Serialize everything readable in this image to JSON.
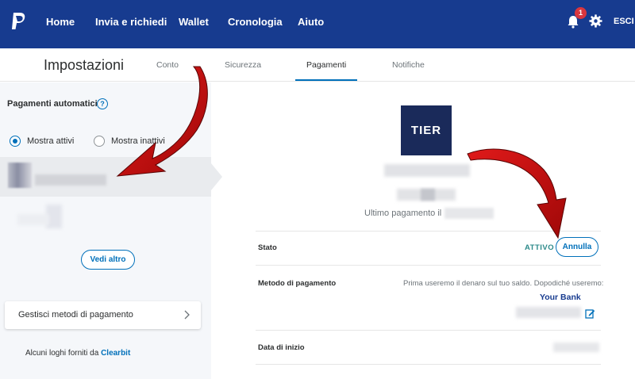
{
  "nav": {
    "items": [
      "Home",
      "Invia e richiedi",
      "Wallet",
      "Cronologia",
      "Aiuto"
    ],
    "notifications_count": "1",
    "logout_label": "ESCI"
  },
  "subnav": {
    "title": "Impostazioni",
    "tabs": [
      "Conto",
      "Sicurezza",
      "Pagamenti",
      "Notifiche"
    ],
    "active_tab": "Pagamenti"
  },
  "left_panel": {
    "title": "Pagamenti automatici",
    "help_icon": "?",
    "filters": [
      {
        "label": "Mostra attivi",
        "selected": true
      },
      {
        "label": "Mostra inattivi",
        "selected": false
      }
    ],
    "see_more_label": "Vedi altro",
    "manage_label": "Gestisci metodi di pagamento",
    "credits_prefix": "Alcuni loghi forniti da",
    "credits_brand": "Clearbit"
  },
  "detail": {
    "merchant_logo_text": "TIER",
    "last_payment_label": "Ultimo pagamento il",
    "status_label": "Stato",
    "status_value": "ATTIVO",
    "cancel_label": "Annulla",
    "method_label": "Metodo di pagamento",
    "method_text": "Prima useremo il denaro sul tuo saldo. Dopodiché useremo:",
    "bank_name": "Your Bank",
    "start_date_label": "Data di inizio"
  },
  "colors": {
    "brand_navy": "#173b8f",
    "link_blue": "#0070ba",
    "status_teal": "#2c8a8a",
    "arrow_red": "#d01010"
  }
}
